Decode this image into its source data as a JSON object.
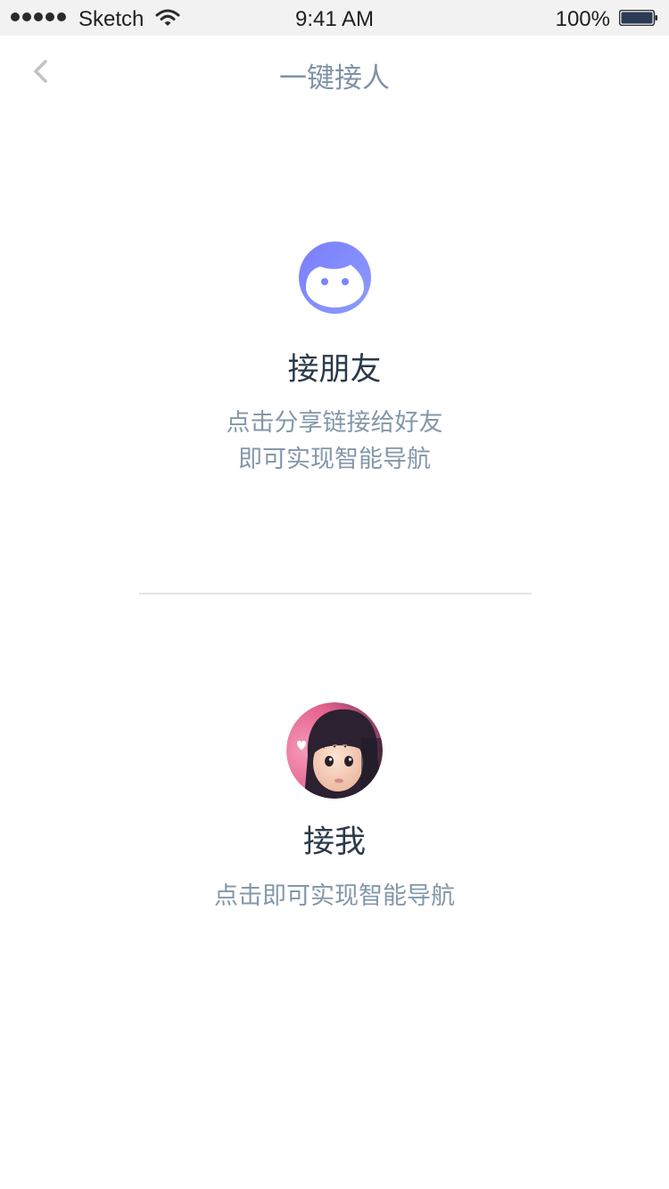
{
  "status_bar": {
    "carrier": "Sketch",
    "time": "9:41 AM",
    "battery": "100%"
  },
  "nav": {
    "title": "一键接人",
    "back_icon": "chevron-left-icon"
  },
  "pickup_friend": {
    "icon": "face-icon",
    "title": "接朋友",
    "desc_line1": "点击分享链接给好友",
    "desc_line2": "即可实现智能导航"
  },
  "pickup_me": {
    "icon": "avatar",
    "title": "接我",
    "desc_line1": "点击即可实现智能导航"
  },
  "colors": {
    "accent": "#7f8cff",
    "title_text": "#2b3a4a",
    "desc_text": "#8497a9",
    "nav_title": "#7f92a6"
  }
}
